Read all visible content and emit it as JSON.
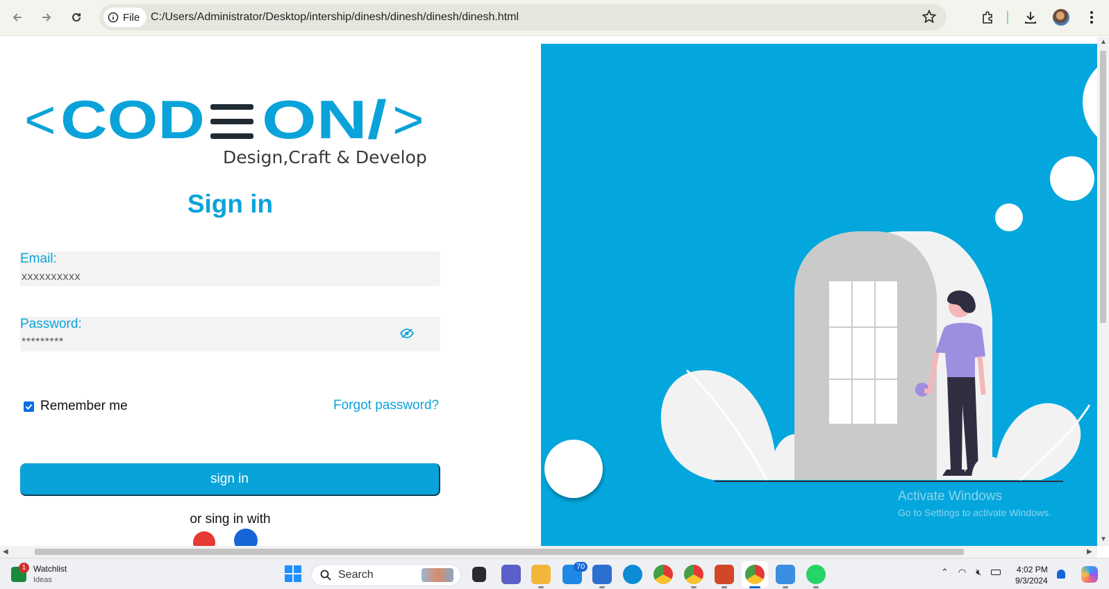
{
  "browser": {
    "file_label": "File",
    "url": "C:/Users/Administrator/Desktop/intership/dinesh/dinesh/dinesh/dinesh.html"
  },
  "page": {
    "logo": {
      "left_bracket": "<",
      "word_a": "COD",
      "word_b": "ON/",
      "right_bracket": ">",
      "tagline": "Design,Craft & Develop"
    },
    "title": "Sign in",
    "email": {
      "label": "Email:",
      "value": "xxxxxxxxxx"
    },
    "password": {
      "label": "Password:",
      "value": "*********"
    },
    "remember_label": "Remember me",
    "remember_checked": true,
    "forgot_label": "Forgot password?",
    "signin_button": "sign in",
    "alt_signin": "or sing in with",
    "colors": {
      "accent": "#0aa3d9",
      "hero_bg": "#04a7dd"
    }
  },
  "watermark": {
    "title": "Activate Windows",
    "subtitle": "Go to Settings to activate Windows."
  },
  "taskbar": {
    "widget_title": "Watchlist",
    "widget_sub": "Ideas",
    "widget_badge": "1",
    "search_label": "Search",
    "mail_badge": "70",
    "time": "4:02 PM",
    "date": "9/3/2024"
  }
}
